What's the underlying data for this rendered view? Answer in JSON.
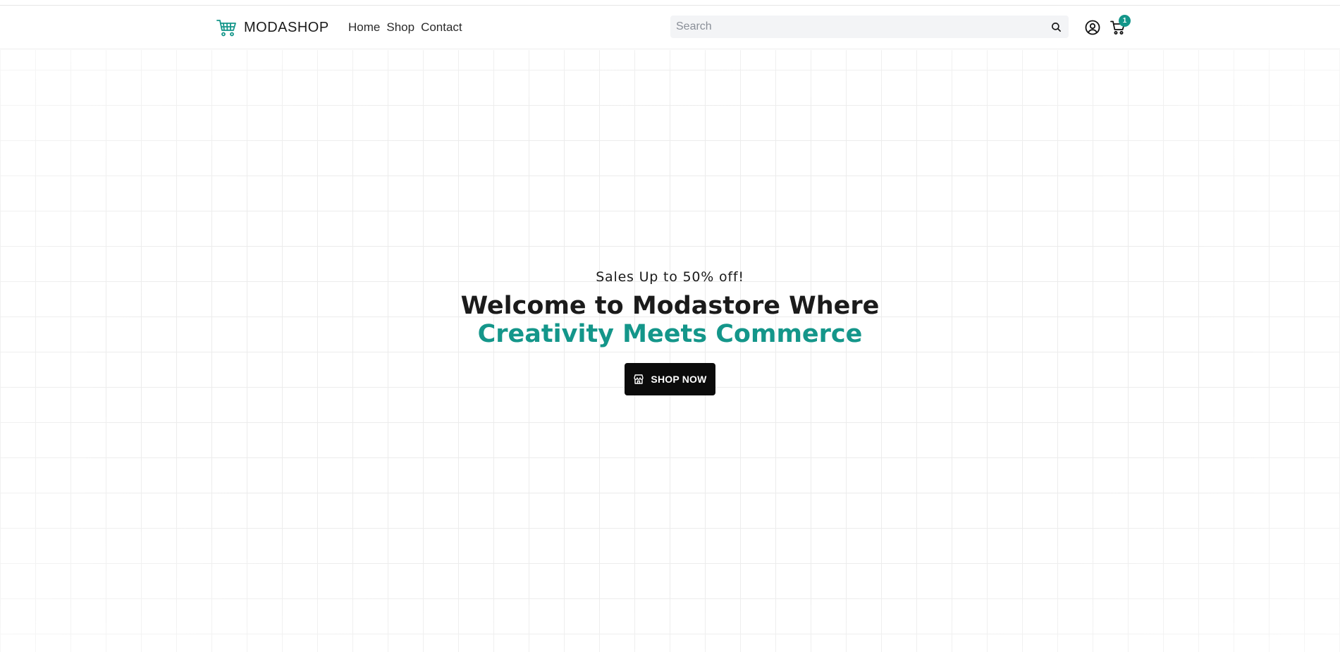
{
  "header": {
    "brand_name": "MODASHOP",
    "nav": [
      {
        "label": "Home"
      },
      {
        "label": "Shop"
      },
      {
        "label": "Contact"
      }
    ],
    "search": {
      "placeholder": "Search",
      "value": ""
    },
    "cart_count": "1"
  },
  "hero": {
    "tagline": "Sales Up to 50% off!",
    "headline_plain": "Welcome to Modastore Where ",
    "headline_accent": "Creativity Meets Commerce",
    "cta_label": "SHOP NOW"
  },
  "colors": {
    "accent": "#14968a",
    "cta_background": "#0b0b0b",
    "search_background": "#f3f4f6",
    "grid_line": "#ececec"
  },
  "icons": {
    "brand": "shopping-cart-icon",
    "search": "search-icon",
    "account": "user-circle-icon",
    "cart": "cart-icon",
    "cta": "store-icon"
  }
}
